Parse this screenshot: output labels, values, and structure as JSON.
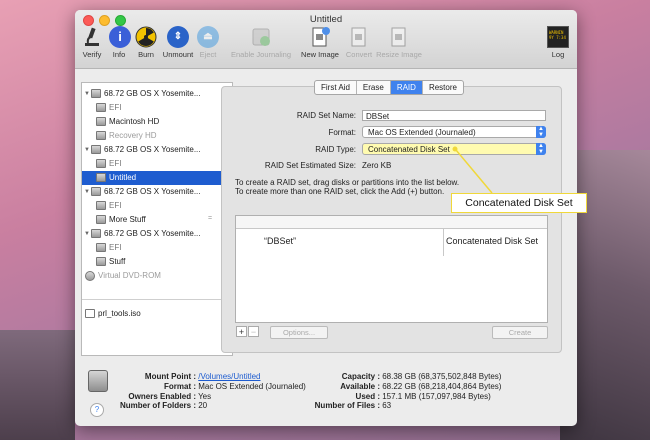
{
  "window": {
    "title": "Untitled"
  },
  "toolbar": {
    "verify": "Verify",
    "info": "Info",
    "burn": "Burn",
    "unmount": "Unmount",
    "eject": "Eject",
    "enable_journaling": "Enable Journaling",
    "new_image": "New Image",
    "convert": "Convert",
    "resize_image": "Resize Image",
    "log": "Log",
    "log_icon_text": "WARNIN\n9Y 7:34"
  },
  "sidebar": {
    "items": [
      {
        "label": "68.72 GB OS X Yosemite..."
      },
      {
        "label": "EFI"
      },
      {
        "label": "Macintosh HD"
      },
      {
        "label": "Recovery HD"
      },
      {
        "label": "68.72 GB OS X Yosemite..."
      },
      {
        "label": "EFI"
      },
      {
        "label": "Untitled"
      },
      {
        "label": "68.72 GB OS X Yosemite..."
      },
      {
        "label": "EFI"
      },
      {
        "label": "More Stuff"
      },
      {
        "label": "68.72 GB OS X Yosemite..."
      },
      {
        "label": "EFI"
      },
      {
        "label": "Stuff"
      },
      {
        "label": "Virtual DVD-ROM"
      },
      {
        "label": "prl_tools.iso"
      }
    ]
  },
  "tabs": [
    "First Aid",
    "Erase",
    "RAID",
    "Restore"
  ],
  "raid": {
    "set_name_label": "RAID Set Name:",
    "set_name_value": "DBSet",
    "format_label": "Format:",
    "format_value": "Mac OS Extended (Journaled)",
    "type_label": "RAID Type:",
    "type_value": "Concatenated Disk Set",
    "size_label": "RAID Set Estimated Size:",
    "size_value": "Zero KB",
    "instructions_1": "To create a RAID set, drag disks or partitions into the list below.",
    "instructions_2": "To create more than one RAID set, click the Add (+) button.",
    "table_row_name": "“DBSet”",
    "table_row_type": "Concatenated Disk Set",
    "add": "+",
    "remove": "−",
    "options": "Options...",
    "create": "Create"
  },
  "callout": {
    "text": "Concatenated Disk Set",
    "color": "#f0d83a"
  },
  "info": {
    "mount_point_label": "Mount Point :",
    "mount_point_value": "/Volumes/Untitled",
    "format_label": "Format :",
    "format_value": "Mac OS Extended (Journaled)",
    "owners_label": "Owners Enabled :",
    "owners_value": "Yes",
    "folders_label": "Number of Folders :",
    "folders_value": "20",
    "capacity_label": "Capacity :",
    "capacity_value": "68.38 GB (68,375,502,848 Bytes)",
    "available_label": "Available :",
    "available_value": "68.22 GB (68,218,404,864 Bytes)",
    "used_label": "Used :",
    "used_value": "157.1 MB (157,097,984 Bytes)",
    "files_label": "Number of Files :",
    "files_value": "63",
    "help": "?"
  }
}
